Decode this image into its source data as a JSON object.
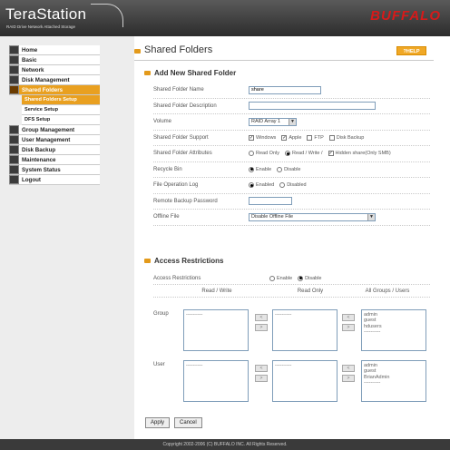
{
  "header": {
    "brand": "TeraStation",
    "brand_sub": "RAID Drive Network Attached Storage",
    "vendor": "BUFFALO"
  },
  "sidebar": {
    "items": [
      {
        "label": "Home",
        "icon": "home-icon"
      },
      {
        "label": "Basic",
        "icon": "basic-icon"
      },
      {
        "label": "Network",
        "icon": "network-icon"
      },
      {
        "label": "Disk Management",
        "icon": "disk-icon"
      },
      {
        "label": "Shared Folders",
        "icon": "folder-icon"
      },
      {
        "label": "Shared Folders Setup",
        "sub": true
      },
      {
        "label": "Service Setup",
        "sub": true
      },
      {
        "label": "DFS Setup",
        "sub": true
      },
      {
        "label": "Group Management",
        "icon": "group-icon"
      },
      {
        "label": "User Management",
        "icon": "user-icon"
      },
      {
        "label": "Disk Backup",
        "icon": "backup-icon"
      },
      {
        "label": "Maintenance",
        "icon": "maintenance-icon"
      },
      {
        "label": "System Status",
        "icon": "status-icon"
      },
      {
        "label": "Logout",
        "icon": "logout-icon"
      }
    ]
  },
  "main": {
    "title": "Shared Folders",
    "help_label": "?HELP",
    "section_add": "Add New Shared Folder",
    "fields": {
      "name_label": "Shared Folder Name",
      "name_value": "share",
      "desc_label": "Shared Folder Description",
      "desc_value": "",
      "volume_label": "Volume",
      "volume_value": "RAID Array 1",
      "support_label": "Shared Folder Support",
      "support_windows": "Windows",
      "support_apple": "Apple",
      "support_ftp": "FTP",
      "support_disk_backup": "Disk Backup",
      "attr_label": "Shared Folder Attributes",
      "attr_read_only": "Read Only",
      "attr_read_write": "Read / Write /",
      "attr_hidden": "Hidden share(Only SMB)",
      "recycle_label": "Recycle Bin",
      "recycle_enable": "Enable",
      "recycle_disable": "Disable",
      "log_label": "File Operation Log",
      "log_enabled": "Enabled",
      "log_disabled": "Disabled",
      "remote_pw_label": "Remote Backup Password",
      "offline_label": "Offline File",
      "offline_value": "Disable Offline File"
    },
    "section_access": "Access Restrictions",
    "access": {
      "label": "Access Restrictions",
      "enable": "Enable",
      "disable": "Disable",
      "col_rw": "Read / Write",
      "col_ro": "Read Only",
      "col_all": "All Groups / Users",
      "group_label": "Group",
      "user_label": "User",
      "rw_group_items": [
        "----------"
      ],
      "ro_group_items": [
        "----------"
      ],
      "all_group_items": [
        "admin",
        "guest",
        "hdusers",
        "----------"
      ],
      "rw_user_items": [
        "----------"
      ],
      "ro_user_items": [
        "----------"
      ],
      "all_user_items": [
        "admin",
        "guest",
        "BrianAdmin",
        "----------"
      ],
      "move_left": "<",
      "move_right": ">"
    },
    "apply_label": "Apply",
    "cancel_label": "Cancel"
  },
  "footer": {
    "copyright": "Copyright 2002-2006 (C) BUFFALO INC. All Rights Reserved."
  },
  "colors": {
    "accent": "#e9a020",
    "vendor_red": "#d61a1a",
    "header_bg": "#3a3a3a"
  }
}
